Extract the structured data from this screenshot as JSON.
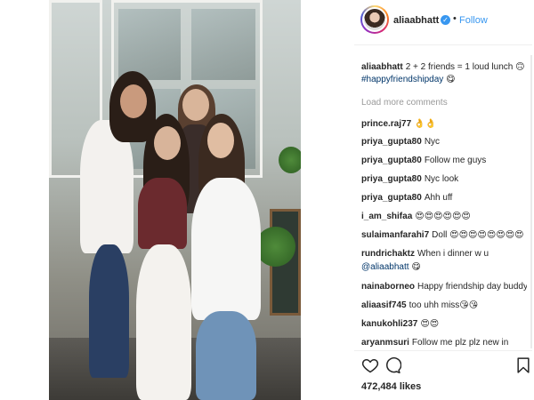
{
  "header": {
    "username": "aliaabhatt",
    "separator": "•",
    "follow_label": "Follow"
  },
  "caption": {
    "username": "aliaabhatt",
    "text": "2 + 2 friends = 1 loud lunch 🙃",
    "hashtag": "#happyfriendshipday",
    "emoji": "😋"
  },
  "load_more_label": "Load more comments",
  "comments": [
    {
      "user": "prince.raj77",
      "text": "👌👌"
    },
    {
      "user": "priya_gupta80",
      "text": "Nyc"
    },
    {
      "user": "priya_gupta80",
      "text": "Follow me guys"
    },
    {
      "user": "priya_gupta80",
      "text": "Nyc look"
    },
    {
      "user": "priya_gupta80",
      "text": "Ahh uff"
    },
    {
      "user": "i_am_shifaa",
      "text": "😍😍😍😍😍😍"
    },
    {
      "user": "sulaimanfarahi7",
      "text": "Doll 😍😍😍😍😍😍😍😍"
    },
    {
      "user": "rundrichaktz",
      "text": "When i dinner w u",
      "mention": "@aliaabhatt",
      "emoji": "😋"
    },
    {
      "user": "nainaborneo",
      "text": "Happy friendship day buddy"
    },
    {
      "user": "aliaasif745",
      "text": "too uhh miss😘😘"
    },
    {
      "user": "kanukohli237",
      "text": "😍😍"
    },
    {
      "user": "aryanmsuri",
      "text": "Follow me plz plz new in"
    }
  ],
  "likes": "472,484 likes",
  "icons": {
    "like": "heart-icon",
    "comment": "comment-icon",
    "save": "bookmark-icon",
    "verified": "verified-badge-icon"
  },
  "colors": {
    "link": "#3897f0",
    "hashtag": "#003569",
    "muted": "#999999",
    "text": "#262626"
  }
}
